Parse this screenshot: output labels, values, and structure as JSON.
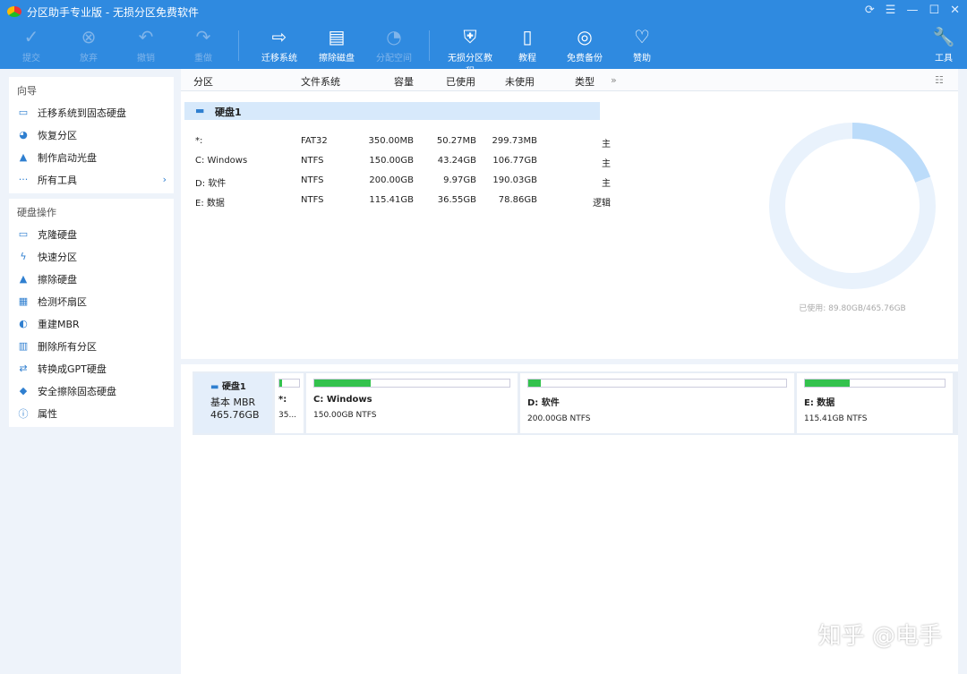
{
  "window": {
    "title": "分区助手专业版 - 无损分区免费软件",
    "controls": [
      "⟳",
      "☰",
      "—",
      "☐",
      "✕"
    ]
  },
  "toolbar": [
    {
      "label": "提交",
      "icon": "✓",
      "disabled": true
    },
    {
      "label": "放弃",
      "icon": "⊗",
      "disabled": true
    },
    {
      "label": "撤销",
      "icon": "↶",
      "disabled": true
    },
    {
      "label": "重做",
      "icon": "↷",
      "disabled": true
    },
    {
      "label": "迁移系统",
      "icon": "⇨",
      "disabled": false
    },
    {
      "label": "擦除磁盘",
      "icon": "▤",
      "disabled": false
    },
    {
      "label": "分配空间",
      "icon": "◔",
      "disabled": true
    },
    {
      "label": "无损分区教程",
      "icon": "⛨",
      "disabled": false
    },
    {
      "label": "教程",
      "icon": "▯",
      "disabled": false
    },
    {
      "label": "免费备份",
      "icon": "◎",
      "disabled": false
    },
    {
      "label": "赞助",
      "icon": "♡",
      "disabled": false
    },
    {
      "label": "工具",
      "icon": "🔧",
      "disabled": false
    }
  ],
  "sidebar": {
    "wizard_title": "向导",
    "wizard": [
      {
        "label": "迁移系统到固态硬盘",
        "icon": "▭"
      },
      {
        "label": "恢复分区",
        "icon": "◕"
      },
      {
        "label": "制作启动光盘",
        "icon": "▲"
      },
      {
        "label": "所有工具",
        "icon": "···"
      }
    ],
    "disk_ops_title": "硬盘操作",
    "disk_ops": [
      {
        "label": "克隆硬盘",
        "icon": "▭"
      },
      {
        "label": "快速分区",
        "icon": "ϟ"
      },
      {
        "label": "擦除硬盘",
        "icon": "▲"
      },
      {
        "label": "检测坏扇区",
        "icon": "▦"
      },
      {
        "label": "重建MBR",
        "icon": "◐"
      },
      {
        "label": "删除所有分区",
        "icon": "▥"
      },
      {
        "label": "转换成GPT硬盘",
        "icon": "⇄"
      },
      {
        "label": "安全擦除固态硬盘",
        "icon": "◆"
      },
      {
        "label": "属性",
        "icon": "ⓘ"
      }
    ]
  },
  "table": {
    "headers": [
      "分区",
      "文件系统",
      "容量",
      "已使用",
      "未使用",
      "类型"
    ],
    "disk": "硬盘1",
    "rows": [
      [
        "*:",
        "FAT32",
        "350.00MB",
        "50.27MB",
        "299.73MB",
        "主"
      ],
      [
        "C: Windows",
        "NTFS",
        "150.00GB",
        "43.24GB",
        "106.77GB",
        "主"
      ],
      [
        "D: 软件",
        "NTFS",
        "200.00GB",
        "9.97GB",
        "190.03GB",
        "主"
      ],
      [
        "E: 数据",
        "NTFS",
        "115.41GB",
        "36.55GB",
        "78.86GB",
        "逻辑"
      ]
    ]
  },
  "usage": {
    "label": "已使用: 89.80GB/465.76GB",
    "used_fraction": 0.193,
    "used_color": "#bcdcfa",
    "free_color": "#e9f2fc"
  },
  "diskmap": {
    "name": "硬盘1",
    "type": "基本 MBR",
    "size": "465.76GB",
    "parts": [
      {
        "name": "*:",
        "info": "35...",
        "fill": 0.14
      },
      {
        "name": "C: Windows",
        "info": "150.00GB NTFS",
        "fill": 0.29
      },
      {
        "name": "D: 软件",
        "info": "200.00GB NTFS",
        "fill": 0.05
      },
      {
        "name": "E: 数据",
        "info": "115.41GB NTFS",
        "fill": 0.32
      }
    ]
  },
  "watermark": "知乎 @电手"
}
